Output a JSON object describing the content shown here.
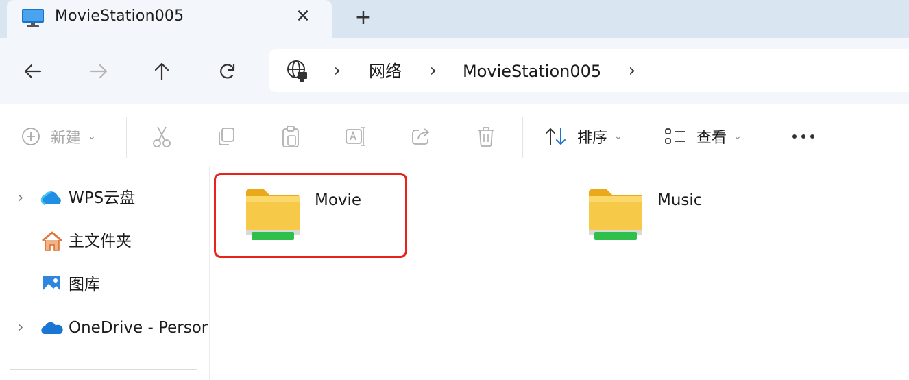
{
  "tab": {
    "title": "MovieStation005",
    "close_icon": "close-icon",
    "new_tab_icon": "plus-icon"
  },
  "nav": {
    "back_icon": "arrow-left-icon",
    "forward_icon": "arrow-right-icon",
    "up_icon": "arrow-up-icon",
    "refresh_icon": "refresh-icon"
  },
  "address": {
    "root_icon": "network-globe-icon",
    "crumbs": [
      "网络",
      "MovieStation005"
    ]
  },
  "toolbar": {
    "new_label": "新建",
    "sort_label": "排序",
    "view_label": "查看",
    "more_icon": "more-icon"
  },
  "sidebar": {
    "items": [
      {
        "label": "WPS云盘",
        "icon": "cloud-icon",
        "expandable": true
      },
      {
        "label": "主文件夹",
        "icon": "home-icon",
        "expandable": false
      },
      {
        "label": "图库",
        "icon": "gallery-icon",
        "expandable": false
      },
      {
        "label": "OneDrive - Persor",
        "icon": "onedrive-icon",
        "expandable": true
      }
    ]
  },
  "content": {
    "items": [
      {
        "name": "Movie",
        "icon": "network-folder-icon",
        "highlighted": true
      },
      {
        "name": "Music",
        "icon": "network-folder-icon",
        "highlighted": false
      }
    ]
  },
  "colors": {
    "tabstrip": "#d9e6f2",
    "navbar": "#f3f6fa",
    "highlight": "#e8231b",
    "folder_yellow": "#f7c948",
    "folder_green": "#2fbf4a",
    "icon_blue": "#1a73c9"
  }
}
